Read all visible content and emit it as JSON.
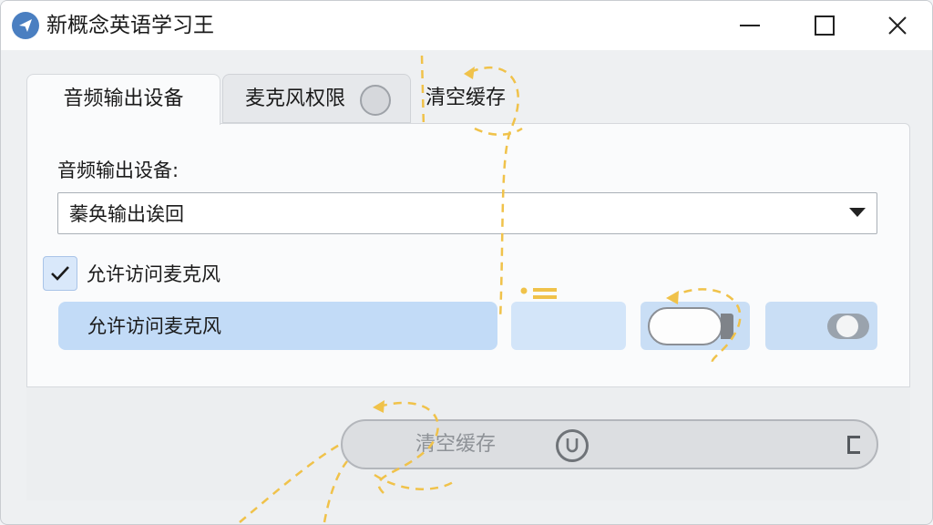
{
  "window": {
    "title": "新概念英语学习王",
    "icon": "send-plane-icon"
  },
  "tabs": [
    {
      "label": "音频输出设备",
      "active": true
    },
    {
      "label": "麦克风权限",
      "active": false
    },
    {
      "label": "清空缓存",
      "active": false
    }
  ],
  "audio": {
    "label": "音频输出设备:",
    "selected": "蓁奂输出诶回"
  },
  "mic": {
    "checkbox_label": "允许访问麦克风",
    "checked": true,
    "button_label": "允许访问麦克风"
  },
  "cache": {
    "button_label": "清空缓存"
  },
  "colors": {
    "accent": "#4a7fc1",
    "selection": "#c2dbf7",
    "annotation": "#f0c24a"
  }
}
